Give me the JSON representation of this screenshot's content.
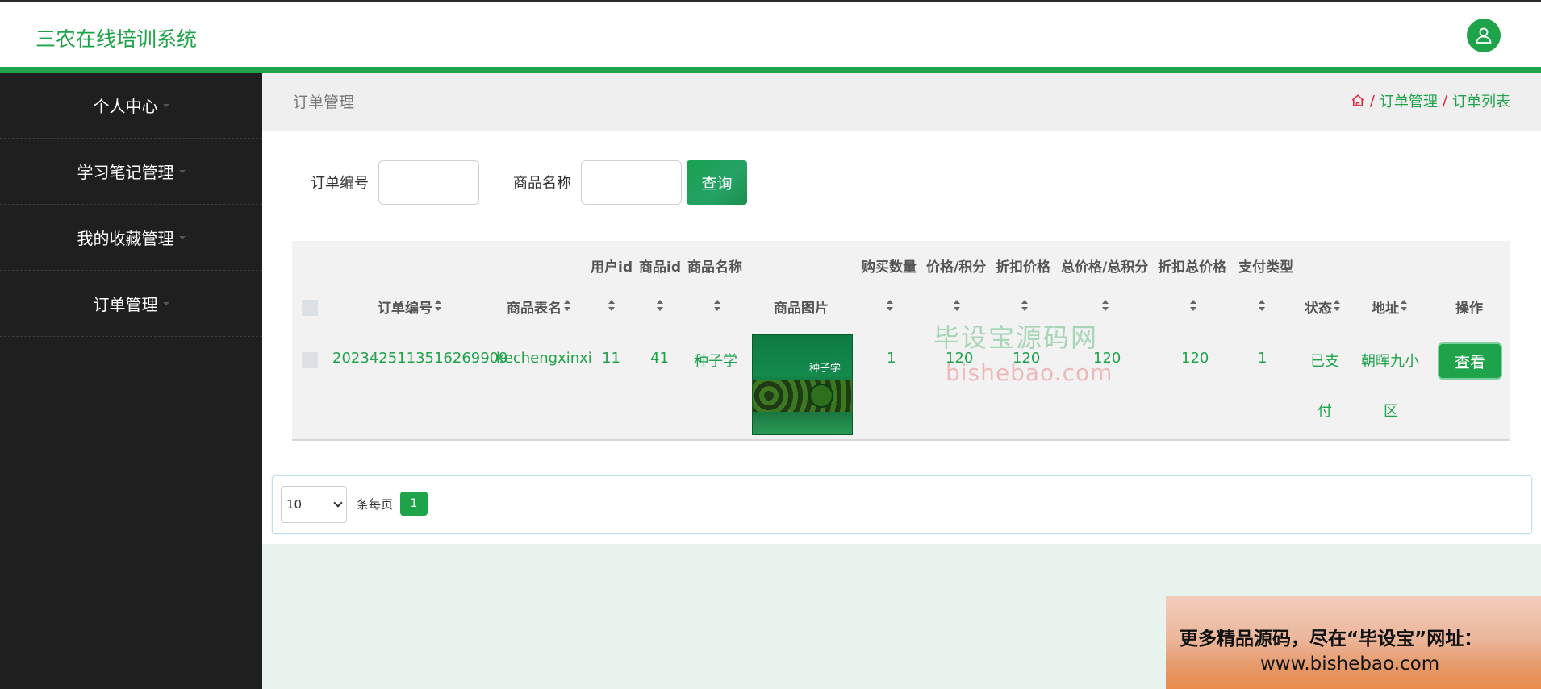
{
  "app": {
    "title": "三农在线培训系统"
  },
  "sidebar": {
    "items": [
      {
        "label": "个人中心"
      },
      {
        "label": "学习笔记管理"
      },
      {
        "label": "我的收藏管理"
      },
      {
        "label": "订单管理"
      }
    ]
  },
  "page": {
    "title": "订单管理",
    "breadcrumb": [
      "订单管理",
      "订单列表"
    ],
    "breadcrumb_sep": "/"
  },
  "search": {
    "order_no_label": "订单编号",
    "order_no_value": "",
    "goods_name_label": "商品名称",
    "goods_name_value": "",
    "query_button": "查询"
  },
  "table": {
    "headers": {
      "order_no": "订单编号",
      "goods_table": "商品表名",
      "user_id": "用户id",
      "goods_id": "商品id",
      "goods_name": "商品名称",
      "goods_image": "商品图片",
      "quantity": "购买数量",
      "price": "价格/积分",
      "discount_price": "折扣价格",
      "total": "总价格/总积分",
      "discount_total": "折扣总价格",
      "pay_type": "支付类型",
      "status": "状态",
      "address": "地址",
      "actions": "操作"
    },
    "rows": [
      {
        "order_no": "2023425113516269909",
        "goods_table": "kechengxinxi",
        "user_id": "11",
        "goods_id": "41",
        "goods_name": "种子学",
        "image_title": "种子学",
        "quantity": "1",
        "price": "120",
        "discount_price": "120",
        "total": "120",
        "discount_total": "120",
        "pay_type": "1",
        "status_line1": "已支",
        "status_line2": "付",
        "address_line1": "朝晖九小",
        "address_line2": "区",
        "view_button": "查看"
      }
    ]
  },
  "pagination": {
    "page_size": "10",
    "per_page_label": "条每页",
    "current_page": "1"
  },
  "watermark": {
    "cn": "毕设宝源码网",
    "en": "bishebao.com"
  },
  "promo": {
    "line1": "更多精品源码，尽在“毕设宝”网址：",
    "line2": "www.bishebao.com"
  },
  "colors": {
    "primary": "#1ea34a",
    "sidebar_bg": "#1f1f1f",
    "page_bg": "#e7f3ec"
  }
}
